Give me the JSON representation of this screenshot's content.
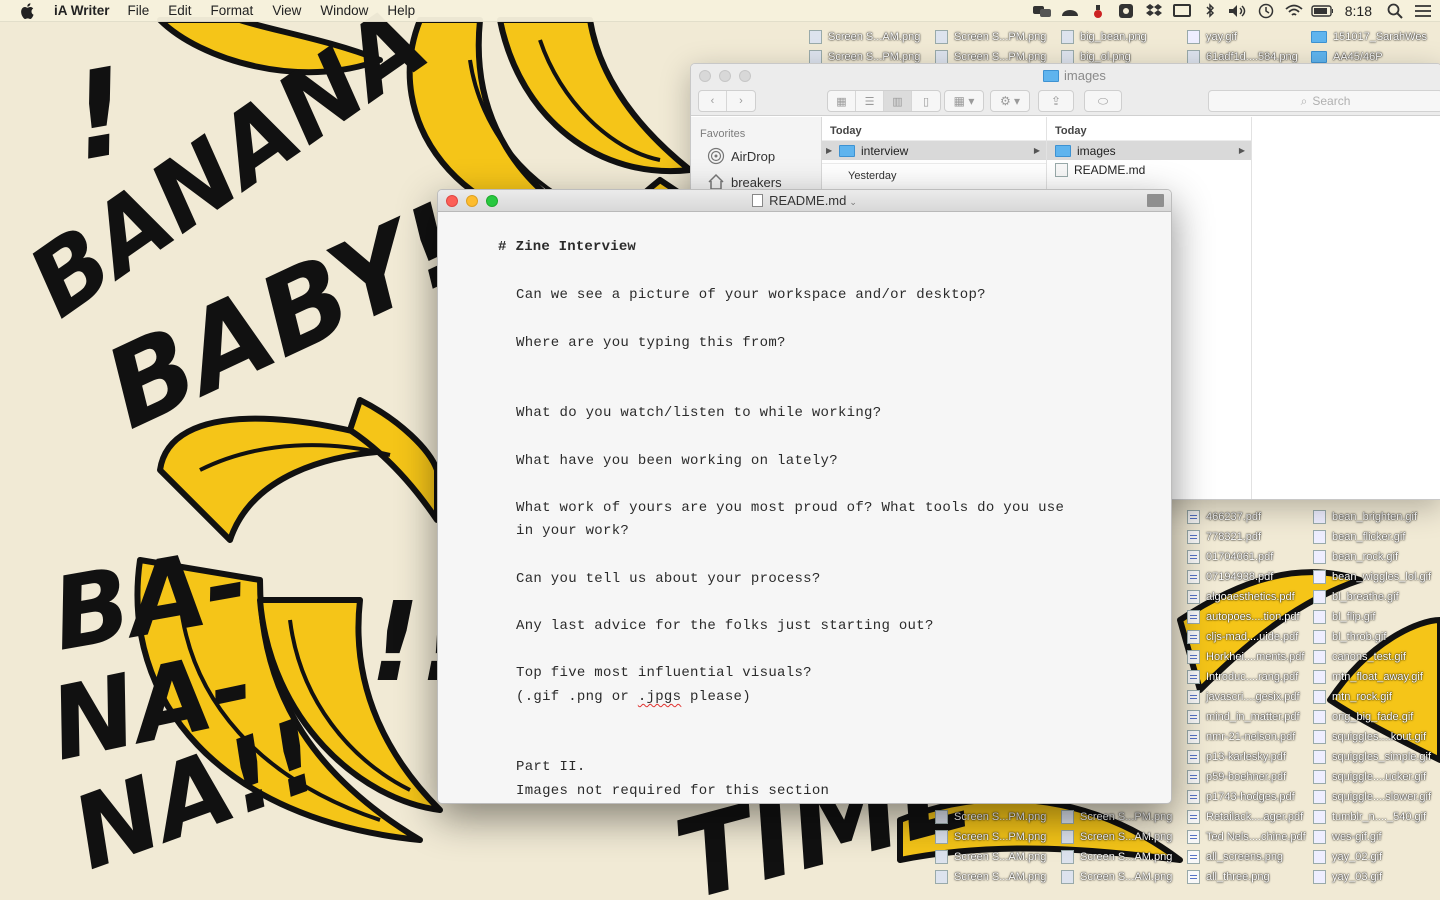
{
  "menubar": {
    "app_name": "iA Writer",
    "items": [
      "File",
      "Edit",
      "Format",
      "View",
      "Window",
      "Help"
    ],
    "clock": "8:18"
  },
  "desktop": {
    "top_files": [
      "Screen S...AM.png",
      "Screen S...PM.png",
      "big_bean.png",
      "yay.gif",
      "151017_SarahWes",
      "Screen S...PM.png",
      "Screen S...PM.png",
      "big_ol.png",
      "61adf1d....584.png",
      "AA45/46P"
    ],
    "right_col1": [
      "466237.pdf",
      "778321.pdf",
      "01704061.pdf",
      "07194938.pdf",
      "algoaesthetics.pdf",
      "autopoes....tion.pdf",
      "cljs-mad....uide.pdf",
      "Horkhei....ments.pdf",
      "Introduc....rang.pdf",
      "javascri....gesix.pdf",
      "mind_in_matter.pdf",
      "nmr-21-nelson.pdf",
      "p13-karlesky.pdf",
      "p59-boehner.pdf",
      "p1743-hodges.pdf",
      "Retailack....ager.pdf",
      "Ted Nels....chine.pdf",
      "all_screens.png",
      "all_three.png"
    ],
    "right_col2": [
      "bean_brighten.gif",
      "bean_flicker.gif",
      "bean_rock.gif",
      "bean_wiggles_lol.gif",
      "bl_breathe.gif",
      "bl_flip.gif",
      "bl_throb.gif",
      "canons_test.gif",
      "mtn_float_away.gif",
      "mtn_rock.gif",
      "orig_big_fade.gif",
      "squiggles....kout.gif",
      "squiggles_simple.gif",
      "squiggle....ucker.gif",
      "squiggle....slower.gif",
      "tumblr_n...._540.gif",
      "wes-gif.gif",
      "yay_02.gif",
      "yay_03.gif"
    ],
    "bottom_files": [
      "Screen S...PM.png",
      "Screen S...PM.png",
      "Screen S...PM.png",
      "Screen S...AM.png",
      "Screen S...AM.png",
      "Screen S...AM.png",
      "Screen S...AM.png",
      "Screen S...AM.png"
    ]
  },
  "finder": {
    "title": "images",
    "search_placeholder": "Search",
    "sidebar_heading": "Favorites",
    "sidebar_items": [
      "AirDrop",
      "breakers"
    ],
    "col1_heading": "Today",
    "col1_rows": [
      "interview"
    ],
    "col1_subheading": "Yesterday",
    "col2_heading": "Today",
    "col2_rows": [
      "images",
      "README.md"
    ]
  },
  "writer": {
    "title": "README.md",
    "heading_mark": "#",
    "heading": "Zine Interview",
    "lines": [
      "Can we see a picture of your workspace and/or desktop?",
      "Where are you typing this from?",
      "What do you watch/listen to while working?",
      "What have you been working on lately?",
      "What work of yours are you most proud of? What tools do you use",
      "in your work?",
      "Can you tell us about your process?",
      "Any last advice for the folks just starting out?",
      "Top five most influential visuals?",
      "(.gif .png or ",
      ".jpgs",
      " please)",
      "Part II.",
      "Images not required for this section"
    ]
  },
  "wallpaper": {
    "text_banana": "BANANA",
    "text_baby": "BABY!",
    "text_ba": "BA-",
    "text_na1": "NA-",
    "text_na2": "NA!!",
    "text_time": "TIME",
    "banana_color": "#f5c518",
    "ink_color": "#111111"
  },
  "colors": {
    "close": "#fc5f57",
    "minimize": "#fdbc2e",
    "zoom": "#28c840",
    "folder": "#5fb4ee"
  }
}
